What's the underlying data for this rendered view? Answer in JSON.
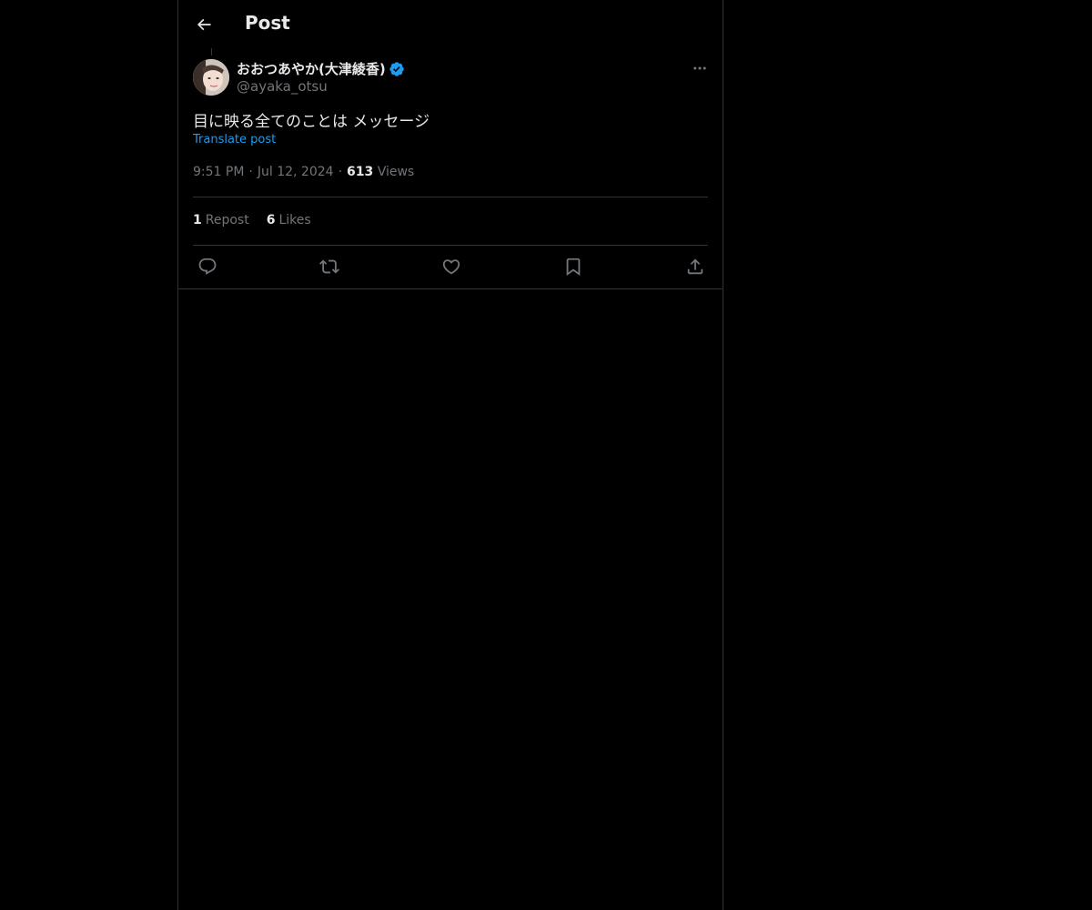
{
  "header": {
    "title": "Post",
    "back_icon": "arrow-left-icon"
  },
  "post": {
    "author": {
      "display_name": "おおつあやか(大津綾香)",
      "handle": "@ayaka_otsu",
      "verified": true,
      "verified_color": "#1d9bf0"
    },
    "text": "目に映る全てのことは メッセージ",
    "translate_label": "Translate post",
    "time": "9:51 PM",
    "separator": "·",
    "date": "Jul 12, 2024",
    "views_count": "613",
    "views_label": "Views"
  },
  "stats": {
    "reposts_count": "1",
    "reposts_label": "Repost",
    "likes_count": "6",
    "likes_label": "Likes"
  },
  "actions": [
    "reply-icon",
    "repost-icon",
    "like-icon",
    "bookmark-icon",
    "share-icon"
  ],
  "colors": {
    "background": "#000000",
    "text": "#e7e9ea",
    "secondary_text": "#71767b",
    "accent": "#1d9bf0",
    "border": "#2f3336"
  }
}
